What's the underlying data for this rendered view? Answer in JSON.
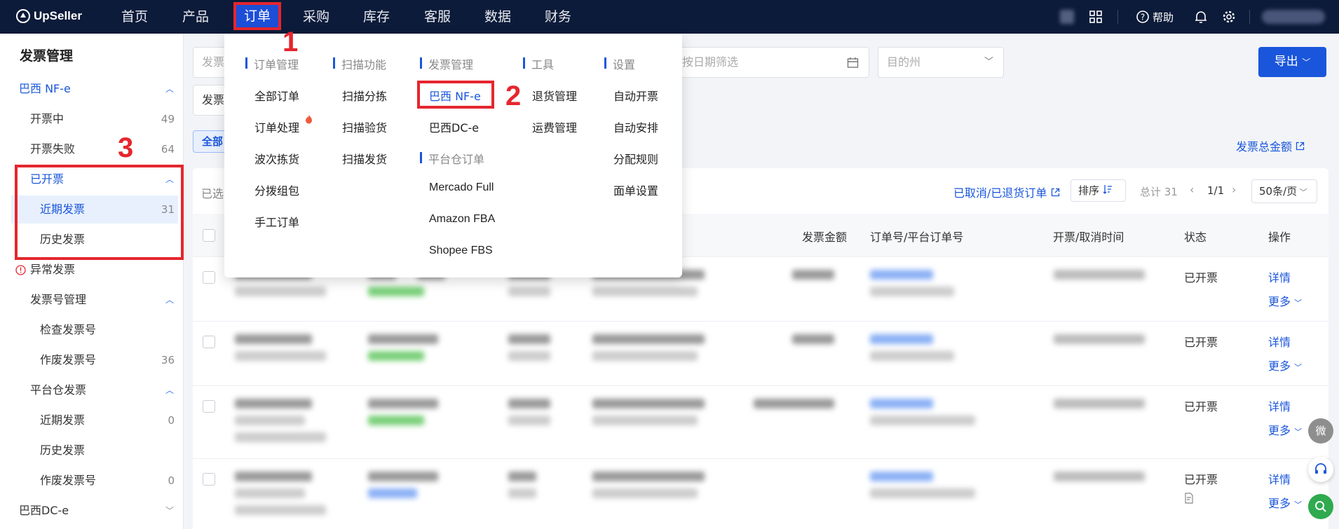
{
  "topbar": {
    "logo": "UpSeller",
    "nav": [
      "首页",
      "产品",
      "订单",
      "采购",
      "库存",
      "客服",
      "数据",
      "财务"
    ],
    "help": "帮助"
  },
  "sidebar": {
    "title": "发票管理",
    "items": [
      {
        "label": "巴西 NF-e",
        "count": "",
        "chev": "^"
      },
      {
        "label": "开票中",
        "count": "49",
        "chev": ""
      },
      {
        "label": "开票失败",
        "count": "64",
        "chev": ""
      },
      {
        "label": "已开票",
        "count": "",
        "chev": "^"
      },
      {
        "label": "近期发票",
        "count": "31",
        "chev": ""
      },
      {
        "label": "历史发票",
        "count": "",
        "chev": ""
      },
      {
        "label": "异常发票",
        "count": "",
        "chev": ""
      },
      {
        "label": "发票号管理",
        "count": "",
        "chev": "^"
      },
      {
        "label": "检查发票号",
        "count": "",
        "chev": ""
      },
      {
        "label": "作废发票号",
        "count": "36",
        "chev": ""
      },
      {
        "label": "平台仓发票",
        "count": "",
        "chev": "^"
      },
      {
        "label": "近期发票",
        "count": "0",
        "chev": ""
      },
      {
        "label": "历史发票",
        "count": "",
        "chev": ""
      },
      {
        "label": "作废发票号",
        "count": "0",
        "chev": ""
      },
      {
        "label": "巴西DC-e",
        "count": "",
        "chev": "v"
      }
    ]
  },
  "filters": {
    "search_placeholder": "发票",
    "date_placeholder": "按日期筛选",
    "state_placeholder": "目的州",
    "type_label": "发票",
    "tab_all": "全部"
  },
  "actions": {
    "export": "导出",
    "total_amount_link": "发票总金额",
    "selected_label": "已选",
    "cancelled_link": "已取消/已退货订单",
    "sort": "排序",
    "total": "总计 31",
    "page": "1/1",
    "page_size": "50条/页"
  },
  "table": {
    "headers": [
      "发票金额",
      "订单号/平台订单号",
      "开票/取消时间",
      "状态",
      "操作"
    ],
    "rows": [
      {
        "status": "已开票",
        "detail": "详情",
        "more": "更多"
      },
      {
        "status": "已开票",
        "detail": "详情",
        "more": "更多"
      },
      {
        "status": "已开票",
        "detail": "详情",
        "more": "更多"
      },
      {
        "status": "已开票",
        "detail": "详情",
        "more": "更多"
      }
    ]
  },
  "dropdown": {
    "columns": [
      {
        "header": "订单管理",
        "items": [
          "全部订单",
          "订单处理",
          "波次拣货",
          "分拨组包",
          "手工订单"
        ]
      },
      {
        "header": "扫描功能",
        "items": [
          "扫描分拣",
          "扫描验货",
          "扫描发货"
        ]
      },
      {
        "header": "发票管理",
        "items": [
          "巴西 NF-e",
          "巴西DC-e"
        ],
        "header2": "平台仓订单",
        "items2": [
          "Mercado Full",
          "Amazon FBA",
          "Shopee FBS"
        ]
      },
      {
        "header": "工具",
        "items": [
          "退货管理",
          "运费管理"
        ]
      },
      {
        "header": "设置",
        "items": [
          "自动开票",
          "自动安排",
          "分配规则",
          "面单设置"
        ]
      }
    ]
  },
  "annotations": [
    "1",
    "2",
    "3"
  ],
  "floating": {
    "wechat": "微"
  },
  "colors": {
    "topbar": "#0d1b3a",
    "accent": "#1a56db",
    "highlight": "#e5262e"
  }
}
